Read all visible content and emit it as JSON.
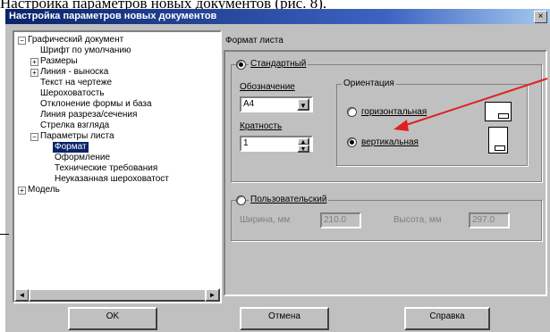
{
  "page_text": "Настройка параметров новых документов (рис. 8).",
  "dialog": {
    "title": "Настройка параметров новых документов",
    "close_label": "×"
  },
  "tree": {
    "items": [
      {
        "label": "Графический документ",
        "toggle": "−"
      },
      {
        "label": "Шрифт по умолчанию"
      },
      {
        "label": "Размеры",
        "toggle": "+"
      },
      {
        "label": "Линия - выноска",
        "toggle": "+"
      },
      {
        "label": "Текст на чертеже"
      },
      {
        "label": "Шероховатость"
      },
      {
        "label": "Отклонение формы и база"
      },
      {
        "label": "Линия разреза/сечения"
      },
      {
        "label": "Стрелка взгляда"
      },
      {
        "label": "Параметры листа",
        "toggle": "−"
      },
      {
        "label": "Формат",
        "selected": true
      },
      {
        "label": "Оформление"
      },
      {
        "label": "Технические требования"
      },
      {
        "label": "Неуказанная шероховатост"
      },
      {
        "label": "Модель",
        "toggle": "+"
      }
    ],
    "scroll_left": "◄",
    "scroll_right": "►"
  },
  "panel": {
    "title": "Формат листа",
    "standard": {
      "label": "Стандартный",
      "selected": true,
      "designation_label": "Обозначение",
      "designation_value": "А4",
      "multiplicity_label": "Кратность",
      "multiplicity_value": "1",
      "dropdown_glyph": "▼",
      "spin_up": "▲",
      "spin_down": "▼"
    },
    "orientation": {
      "label": "Ориентация",
      "horizontal": "горизонтальная",
      "vertical": "вертикальная",
      "selected": "vertical"
    },
    "custom": {
      "label": "Пользовательский",
      "width_label": "Ширина, мм",
      "width_value": "210.0",
      "height_label": "Высота, мм",
      "height_value": "297.0"
    }
  },
  "buttons": {
    "ok": "OK",
    "cancel": "Отмена",
    "help": "Справка"
  },
  "colors": {
    "titlebar": "#0a246a",
    "selection": "#0a246a",
    "annotation_arrow": "#e02020"
  }
}
